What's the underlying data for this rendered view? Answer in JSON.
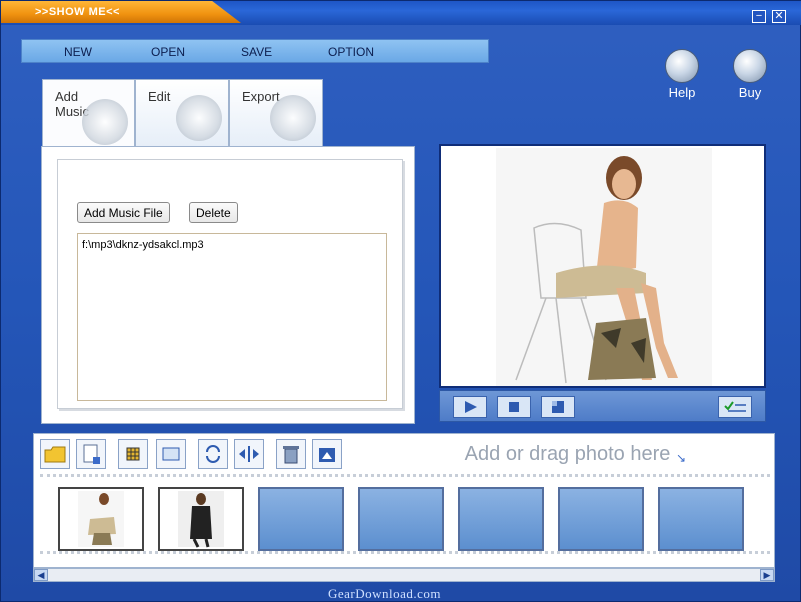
{
  "window": {
    "title": ">>SHOW ME<<",
    "minimize": "−",
    "close": "✕"
  },
  "menu": [
    {
      "label": "NEW"
    },
    {
      "label": "OPEN"
    },
    {
      "label": "SAVE"
    },
    {
      "label": "OPTION"
    }
  ],
  "top_icons": [
    {
      "label": "Help",
      "icon": "help-icon"
    },
    {
      "label": "Buy",
      "icon": "buy-icon"
    }
  ],
  "tabs": [
    {
      "label": "Add\nMusic",
      "active": true
    },
    {
      "label": "Edit",
      "active": false
    },
    {
      "label": "Export",
      "active": false
    }
  ],
  "music": {
    "add_button": "Add Music File",
    "delete_button": "Delete",
    "files": [
      "f:\\mp3\\dknz-ydsakcl.mp3"
    ]
  },
  "player": {
    "controls": [
      "play-icon",
      "stop-icon",
      "pause-icon",
      "toggle-icon"
    ]
  },
  "photo_panel": {
    "hint": "Add or drag photo here"
  },
  "watermark": "GearDownload.com"
}
